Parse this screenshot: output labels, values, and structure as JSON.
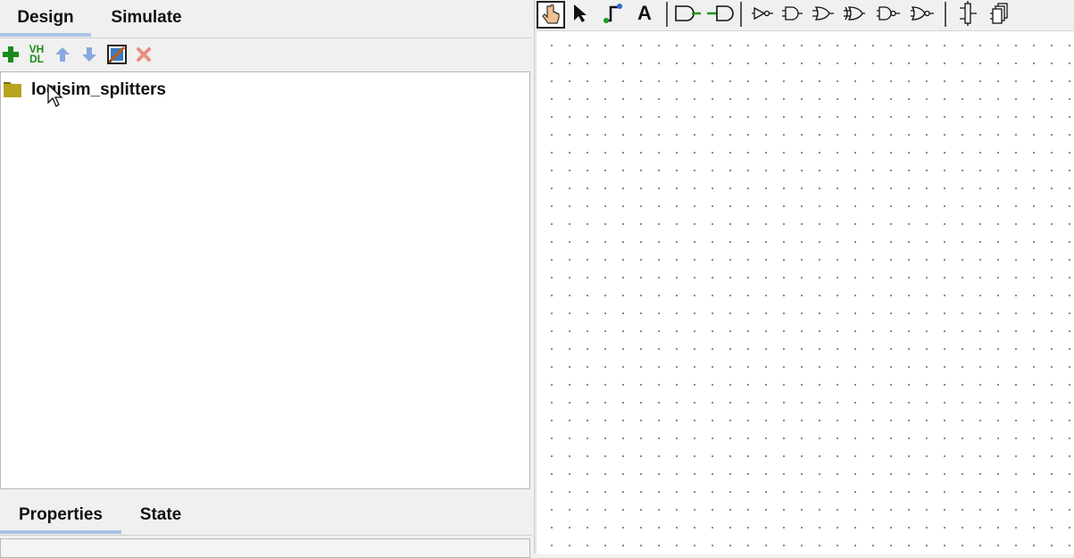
{
  "explorer": {
    "tabs": [
      "Design",
      "Simulate"
    ],
    "active_tab": "Design",
    "toolbar": {
      "icons": [
        "add-circuit-icon",
        "add-vhdl-icon",
        "move-up-icon",
        "move-down-icon",
        "edit-appearance-icon",
        "delete-icon"
      ],
      "vhdl_label_top": "VH",
      "vhdl_label_bottom": "DL"
    },
    "tree": {
      "items": [
        {
          "label": "logisim_splitters",
          "icon": "folder-icon"
        }
      ]
    }
  },
  "attributes": {
    "tabs": [
      "Properties",
      "State"
    ],
    "active_tab": "Properties"
  },
  "main_toolbar": {
    "icons": [
      "poke-tool-icon",
      "select-tool-icon",
      "wiring-tool-icon",
      "text-tool-icon",
      "input-pin-icon",
      "output-pin-icon",
      "not-gate-icon",
      "buffer-icon",
      "and-gate-icon",
      "or-gate-icon",
      "xor-gate-icon",
      "nand-gate-icon",
      "nor-gate-icon",
      "splitter-icon",
      "probe-icon"
    ],
    "text_tool_label": "A",
    "active_tool": "poke-tool-icon"
  },
  "colors": {
    "accent_tab": "#a9c4e4",
    "folder": "#b8a41c",
    "add_green": "#1a8a1a",
    "arrow_blue": "#8aa8e0",
    "delete_red": "#e89080"
  }
}
